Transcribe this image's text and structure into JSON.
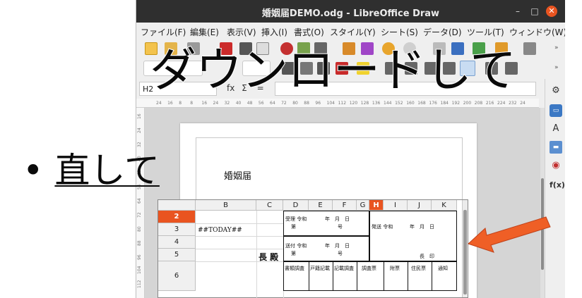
{
  "window": {
    "title": "婚姻届DEMO.odg - LibreOffice Draw",
    "controls": {
      "minimize": "–",
      "maximize": "□",
      "close": "✕"
    }
  },
  "menubar": {
    "items": [
      "ファイル(F)",
      "編集(E)",
      "表示(V)",
      "挿入(I)",
      "書式(O)",
      "スタイル(Y)",
      "シート(S)",
      "データ(D)",
      "ツール(T)",
      "ウィンドウ(W)"
    ]
  },
  "formulabar": {
    "name_box": "H2",
    "sigma": "Σ",
    "equals": "=",
    "fx": "fx"
  },
  "ruler": {
    "h_ticks": [
      "24",
      "16",
      "8",
      "8",
      "16",
      "24",
      "32",
      "40",
      "48",
      "56",
      "64",
      "72",
      "80",
      "88",
      "96",
      "104",
      "112",
      "120",
      "128",
      "136",
      "144",
      "152",
      "160",
      "168",
      "176",
      "184",
      "192",
      "200",
      "208",
      "216",
      "224",
      "232",
      "24"
    ],
    "v_ticks": [
      "16",
      "24",
      "32",
      "40",
      "48",
      "56",
      "64",
      "72",
      "80",
      "88",
      "96",
      "104",
      "112"
    ]
  },
  "document": {
    "title": "婚姻届"
  },
  "sheet": {
    "columns": [
      "B",
      "C",
      "D",
      "E",
      "F",
      "G",
      "H",
      "I",
      "J",
      "K"
    ],
    "active_column": "H",
    "rows": [
      "2",
      "3",
      "4",
      "5",
      "6"
    ],
    "active_row": "2",
    "cells": {
      "b3": "##TODAY##",
      "c5": "長 殿",
      "received": "受理 令和",
      "received_day": "年　月　日",
      "received_no": "第",
      "received_go": "号",
      "sent": "送付 令和",
      "sent_day": "年　月　日",
      "sent_no": "第",
      "sent_go": "号",
      "issued": "発送 令和",
      "issued_day": "年　月　日",
      "chief_seal": "長　印",
      "doc_check": "書類調査",
      "registry": "戸籍記載",
      "record_check": "記載調査",
      "check_slip": "調査票",
      "attached": "附票",
      "resident": "住民票",
      "notice": "通知"
    }
  },
  "sidebar": {
    "icons": [
      "gear-icon",
      "properties-icon",
      "styles-icon",
      "gallery-icon",
      "navigator-icon",
      "functions-icon"
    ],
    "fx_label": "f(x)"
  },
  "overlay": {
    "headline": "ダウンロードして",
    "bullet": "•",
    "bullet_text": "直して"
  },
  "colors": {
    "accent": "#e95420",
    "titlebar": "#2f2f2f"
  }
}
